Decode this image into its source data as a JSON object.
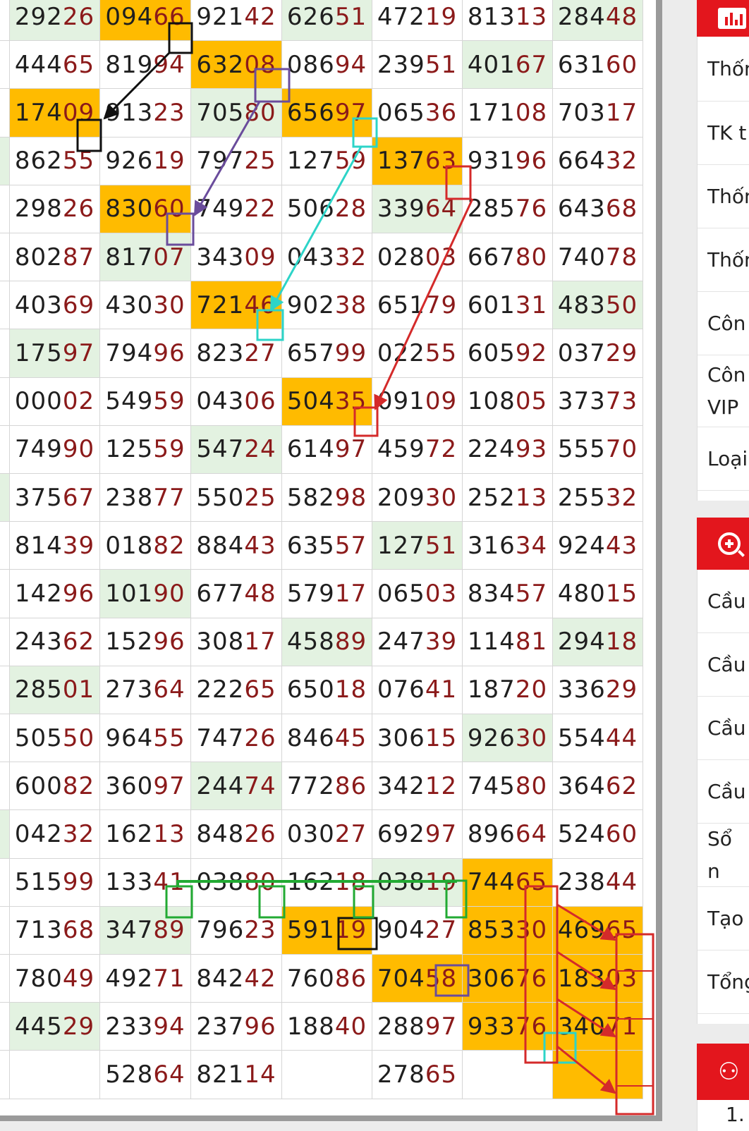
{
  "table": {
    "columns": 7,
    "rows": [
      [
        "29226",
        "09466",
        "92142",
        "62651",
        "47219",
        "81313",
        "28448"
      ],
      [
        "44465",
        "81994",
        "63208",
        "08694",
        "23951",
        "40167",
        "63160"
      ],
      [
        "17409",
        "91323",
        "70580",
        "65697",
        "06536",
        "17108",
        "70317"
      ],
      [
        "86255",
        "92619",
        "79725",
        "12759",
        "13763",
        "93196",
        "66432"
      ],
      [
        "29826",
        "83060",
        "74922",
        "50628",
        "33964",
        "28576",
        "64368"
      ],
      [
        "80287",
        "81707",
        "34309",
        "04332",
        "02803",
        "66780",
        "74078"
      ],
      [
        "40369",
        "43030",
        "72146",
        "90238",
        "65179",
        "60131",
        "48350"
      ],
      [
        "17597",
        "79496",
        "82327",
        "65799",
        "02255",
        "60592",
        "03729"
      ],
      [
        "00002",
        "54959",
        "04306",
        "50435",
        "09109",
        "10805",
        "37373"
      ],
      [
        "74990",
        "12559",
        "54724",
        "61497",
        "45972",
        "22493",
        "55570"
      ],
      [
        "37567",
        "23877",
        "55025",
        "58298",
        "20930",
        "25213",
        "25532"
      ],
      [
        "81439",
        "01882",
        "88443",
        "63557",
        "12751",
        "31634",
        "92443"
      ],
      [
        "14296",
        "10190",
        "67748",
        "57917",
        "06503",
        "83457",
        "48015"
      ],
      [
        "24362",
        "15296",
        "30817",
        "45889",
        "24739",
        "11481",
        "29418"
      ],
      [
        "28501",
        "27364",
        "22265",
        "65018",
        "07641",
        "18720",
        "33629"
      ],
      [
        "50550",
        "96455",
        "74726",
        "84645",
        "30615",
        "92630",
        "55444"
      ],
      [
        "60082",
        "36097",
        "24474",
        "77286",
        "34212",
        "74580",
        "36462"
      ],
      [
        "04232",
        "16213",
        "84826",
        "03027",
        "69297",
        "89664",
        "52460"
      ],
      [
        "51599",
        "13341",
        "03880",
        "16218",
        "03819",
        "74465",
        "23844"
      ],
      [
        "71368",
        "34789",
        "79623",
        "59119",
        "90427",
        "85330",
        "46965"
      ],
      [
        "78049",
        "49271",
        "84242",
        "76086",
        "70458",
        "30676",
        "18303"
      ],
      [
        "44529",
        "23394",
        "23796",
        "18840",
        "28897",
        "93376",
        "34071"
      ],
      [
        "",
        "52864",
        "82114",
        "",
        "27865",
        "",
        ""
      ]
    ]
  },
  "highlight_colors": {
    "orange": "#ffbb00",
    "green": "#e3f2e1",
    "number_tail": "#8b1a1a"
  },
  "sidebar": {
    "icons": [
      "bar-chart-icon",
      "zoom-in-icon",
      "users-icon"
    ],
    "items": [
      "Thốn",
      "TK t",
      "Thốn",
      "Thốn",
      "Côn",
      "Côn\nVIP",
      "Loại",
      "Cầu",
      "Cầu",
      "Cầu",
      "Cầu",
      "Sổ n",
      "Tạo",
      "Tổng"
    ],
    "footer_number": "1."
  }
}
